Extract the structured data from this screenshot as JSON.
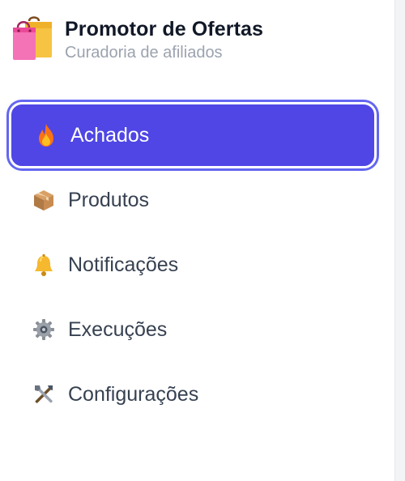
{
  "brand": {
    "title": "Promotor de Ofertas",
    "subtitle": "Curadoria de afiliados",
    "logo_icon": "shopping-bags-icon"
  },
  "nav": {
    "items": [
      {
        "label": "Achados",
        "icon": "fire-icon",
        "active": true
      },
      {
        "label": "Produtos",
        "icon": "package-icon",
        "active": false
      },
      {
        "label": "Notificações",
        "icon": "bell-icon",
        "active": false
      },
      {
        "label": "Execuções",
        "icon": "gear-icon",
        "active": false
      },
      {
        "label": "Configurações",
        "icon": "tools-icon",
        "active": false
      }
    ]
  },
  "colors": {
    "accent": "#4f46e5",
    "accent_ring": "#6366f1",
    "title": "#111827",
    "subtitle": "#9ca3af",
    "nav_text": "#374151"
  }
}
